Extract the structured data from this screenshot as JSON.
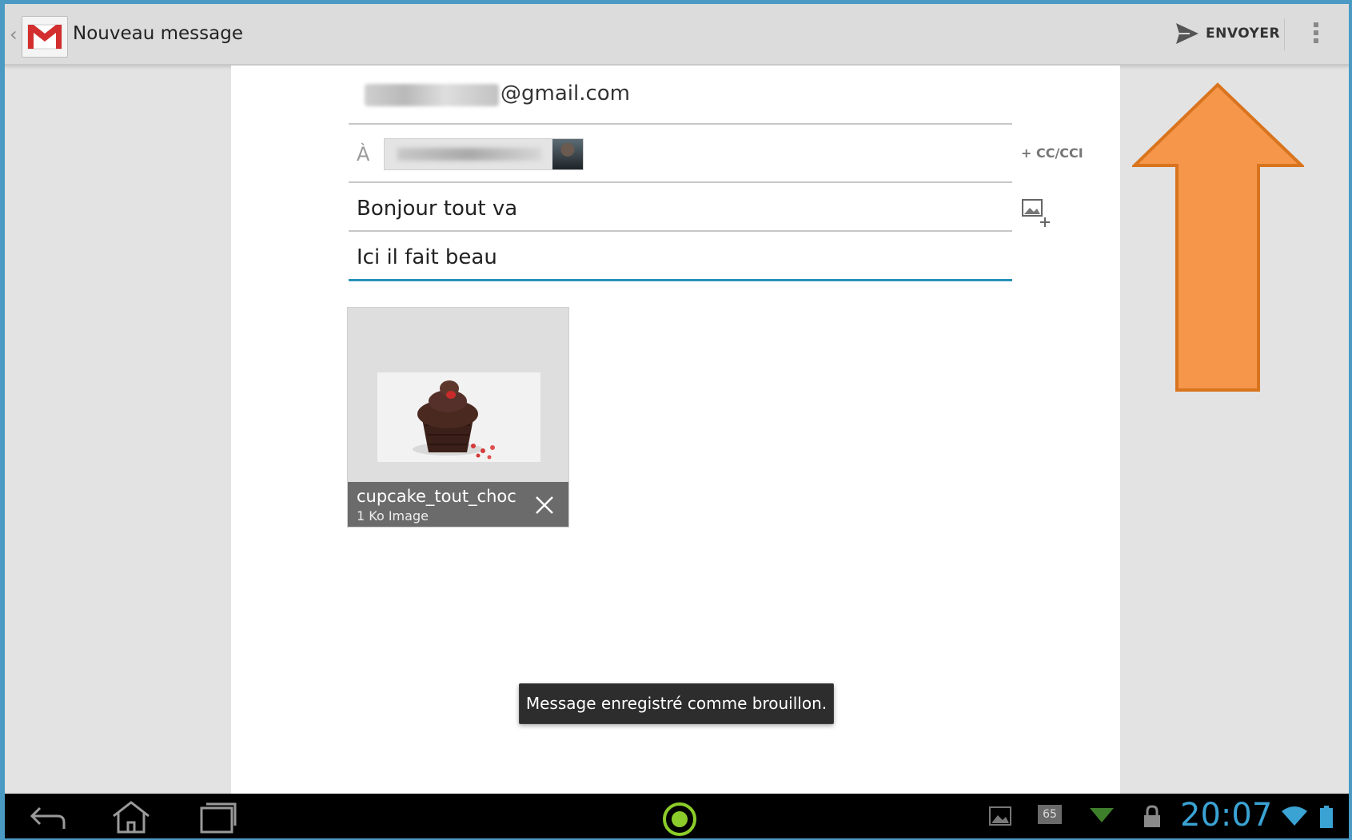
{
  "action_bar": {
    "title": "Nouveau message",
    "send_label": "ENVOYER"
  },
  "compose": {
    "from_visible_text": "@gmail.com",
    "to_label": "À",
    "cc_link": "+ CC/CCI",
    "subject": "Bonjour tout va",
    "body": "Ici il fait beau"
  },
  "attachment": {
    "name": "cupcake_tout_choc",
    "meta": "1 Ko Image"
  },
  "toast": {
    "text": "Message enregistré comme brouillon."
  },
  "system_bar": {
    "clock": "20:07",
    "battery_badge": "65"
  },
  "colors": {
    "accent": "#2a93b9",
    "clock": "#3aa3d4",
    "gmail_red": "#d32f2f",
    "annotation_arrow": "#f5964a"
  },
  "icons": [
    "up-caret-icon",
    "gmail-icon",
    "send-icon",
    "overflow-menu-icon",
    "attach-image-icon",
    "close-icon",
    "back-icon",
    "home-icon",
    "recent-apps-icon",
    "launcher-icon",
    "gallery-icon",
    "notification-icon",
    "lock-icon",
    "wifi-icon",
    "battery-icon"
  ]
}
